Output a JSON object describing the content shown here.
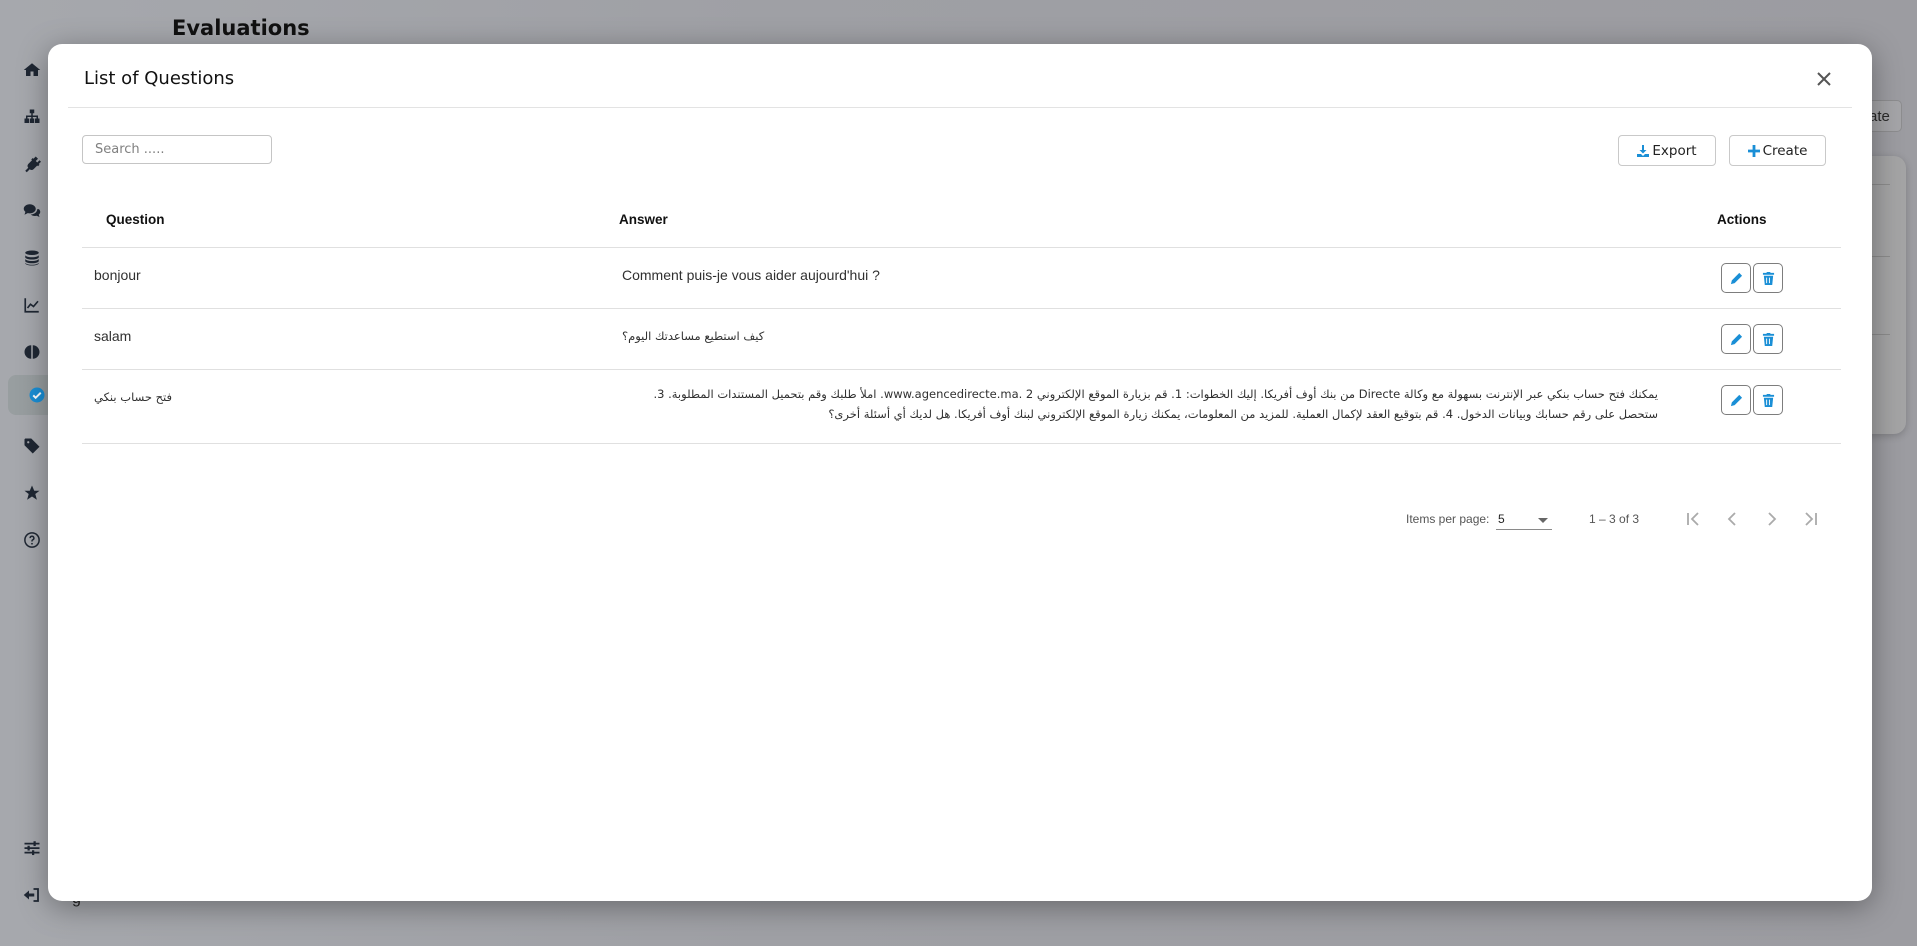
{
  "background": {
    "page_title": "Evaluations",
    "create_button_partial": "ate",
    "logout_partial": "g",
    "sidebar": {
      "items": [
        {
          "icon": "home-icon"
        },
        {
          "icon": "sitemap-icon"
        },
        {
          "icon": "plug-icon"
        },
        {
          "icon": "comments-icon"
        },
        {
          "icon": "database-icon"
        },
        {
          "icon": "chart-line-icon"
        },
        {
          "icon": "brain-icon"
        },
        {
          "icon": "check-circle-icon",
          "active": true
        },
        {
          "icon": "tag-icon"
        },
        {
          "icon": "star-icon"
        },
        {
          "icon": "question-circle-icon"
        }
      ],
      "bottom_items": [
        {
          "icon": "sliders-icon"
        },
        {
          "icon": "logout-icon"
        }
      ]
    }
  },
  "modal": {
    "title": "List of Questions",
    "close_icon": "close-icon",
    "search": {
      "placeholder": "Search .....",
      "value": ""
    },
    "export_label": "Export",
    "create_label": "Create",
    "accent_color": "#1a8fd6",
    "table": {
      "columns": [
        "Question",
        "Answer",
        "Actions"
      ],
      "rows": [
        {
          "question": "bonjour",
          "answer": "Comment puis-je vous aider aujourd'hui ?"
        },
        {
          "question": "salam",
          "answer": "كيف استطيع مساعدتك اليوم؟"
        },
        {
          "question": "فتح حساب بنكي",
          "answer": "يمكنك فتح حساب بنكي عبر الإنترنت بسهولة مع وكالة Directe من بنك أوف أفريكا. إليك الخطوات: 1. قم بزيارة الموقع الإلكتروني www.agencedirecte.ma. 2. املأ طلبك وقم بتحميل المستندات المطلوبة. 3. ستحصل على رقم حسابك وبيانات الدخول. 4. قم بتوقيع العقد لإكمال العملية. للمزيد من المعلومات، يمكنك زيارة الموقع الإلكتروني لبنك أوف أفريكا. هل لديك أي أسئلة أخرى؟"
        }
      ]
    },
    "paginator": {
      "items_per_page_label": "Items per page:",
      "items_per_page": "5",
      "range_label": "1 – 3 of 3"
    }
  }
}
